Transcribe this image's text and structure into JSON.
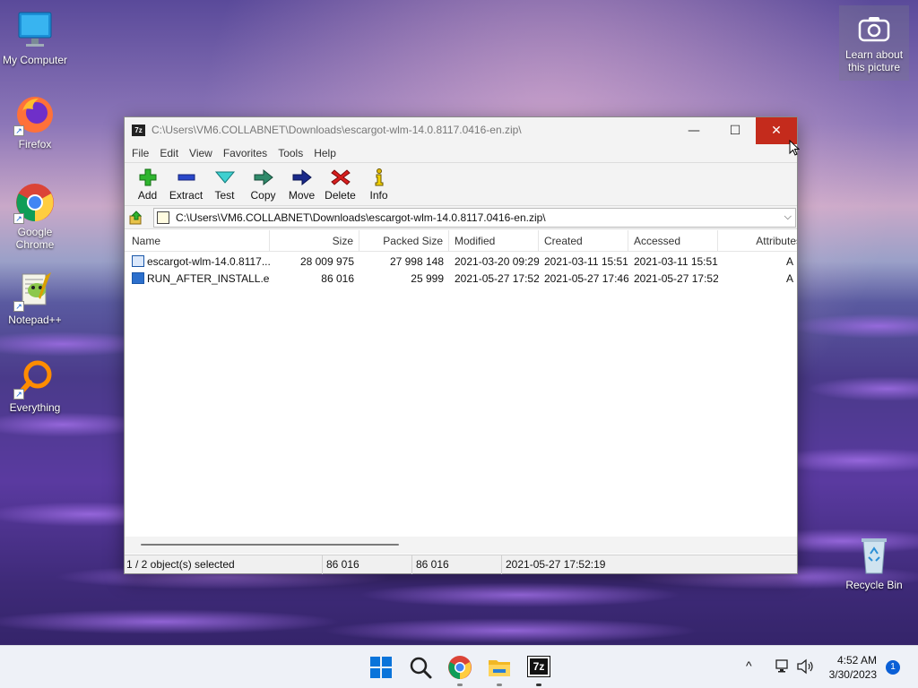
{
  "desktop": {
    "icons": [
      {
        "label": "My Computer"
      },
      {
        "label": "Firefox"
      },
      {
        "label": "Google Chrome"
      },
      {
        "label": "Notepad++"
      },
      {
        "label": "Everything"
      }
    ],
    "recycle_bin": {
      "label": "Recycle Bin"
    },
    "learn_picture": {
      "label": "Learn about this picture"
    }
  },
  "window": {
    "app_icon": "7z",
    "title": "C:\\Users\\VM6.COLLABNET\\Downloads\\escargot-wlm-14.0.8117.0416-en.zip\\",
    "controls": {
      "minimize": "—",
      "maximize": "☐",
      "close": "✕"
    },
    "menu": [
      "File",
      "Edit",
      "View",
      "Favorites",
      "Tools",
      "Help"
    ],
    "toolbar": [
      {
        "label": "Add",
        "icon": "add-icon"
      },
      {
        "label": "Extract",
        "icon": "extract-icon"
      },
      {
        "label": "Test",
        "icon": "test-icon"
      },
      {
        "label": "Copy",
        "icon": "copy-icon"
      },
      {
        "label": "Move",
        "icon": "move-icon"
      },
      {
        "label": "Delete",
        "icon": "delete-icon"
      },
      {
        "label": "Info",
        "icon": "info-icon"
      }
    ],
    "address": "C:\\Users\\VM6.COLLABNET\\Downloads\\escargot-wlm-14.0.8117.0416-en.zip\\",
    "columns": [
      "Name",
      "Size",
      "Packed Size",
      "Modified",
      "Created",
      "Accessed",
      "Attributes"
    ],
    "rows": [
      {
        "name": "escargot-wlm-14.0.8117...",
        "size": "28 009 975",
        "packed": "27 998 148",
        "modified": "2021-03-20 09:29",
        "created": "2021-03-11 15:51",
        "accessed": "2021-03-11 15:51",
        "attr": "A"
      },
      {
        "name": "RUN_AFTER_INSTALL.exe",
        "size": "86 016",
        "packed": "25 999",
        "modified": "2021-05-27 17:52",
        "created": "2021-05-27 17:46",
        "accessed": "2021-05-27 17:52",
        "attr": "A"
      }
    ],
    "status": {
      "selected": "1 / 2 object(s) selected",
      "size": "86 016",
      "packed": "86 016",
      "modified": "2021-05-27 17:52:19"
    }
  },
  "taskbar": {
    "apps": [
      "start",
      "search",
      "chrome",
      "file-explorer",
      "7zip"
    ],
    "seven_zip_label": "7z",
    "tray": {
      "chevron": "^"
    },
    "time": "4:52 AM",
    "date": "3/30/2023",
    "notifications": "1"
  }
}
